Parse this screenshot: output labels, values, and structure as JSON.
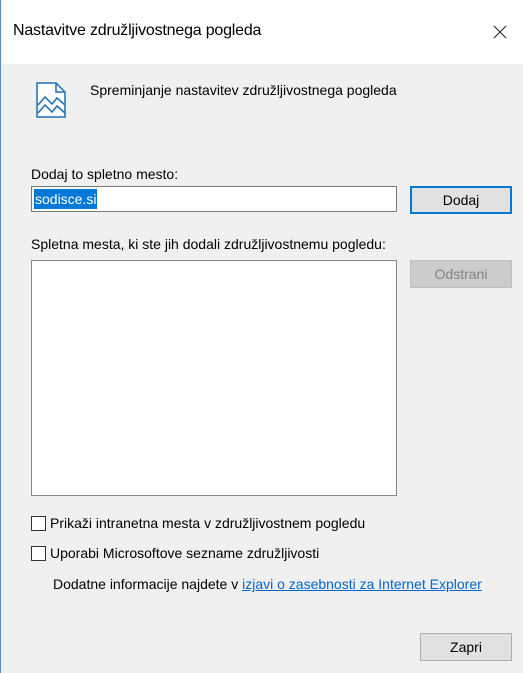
{
  "window": {
    "title": "Nastavitve združljivostnega pogleda",
    "close_label": "×"
  },
  "header": {
    "icon": "compatibility-view-icon",
    "text": "Spreminjanje nastavitev združljivostnega pogleda"
  },
  "add_site": {
    "label": "Dodaj to spletno mesto:",
    "value": "sodisce.si",
    "button_label": "Dodaj"
  },
  "sites_list": {
    "label": "Spletna mesta, ki ste jih dodali združljivostnemu pogledu:",
    "items": [],
    "remove_button_label": "Odstrani"
  },
  "options": {
    "intranet": {
      "label": "Prikaži intranetna mesta v združljivostnem pogledu",
      "checked": false
    },
    "microsoft_lists": {
      "label": "Uporabi Microsoftove sezname združljivosti",
      "checked": false
    }
  },
  "info": {
    "text": "Dodatne informacije najdete v ",
    "link_text": "izjavi o zasebnosti za Internet Explorer"
  },
  "footer": {
    "close_button_label": "Zapri"
  },
  "colors": {
    "accent": "#0078d7",
    "link": "#0066cc",
    "dialog_background": "#f0f0f0"
  }
}
